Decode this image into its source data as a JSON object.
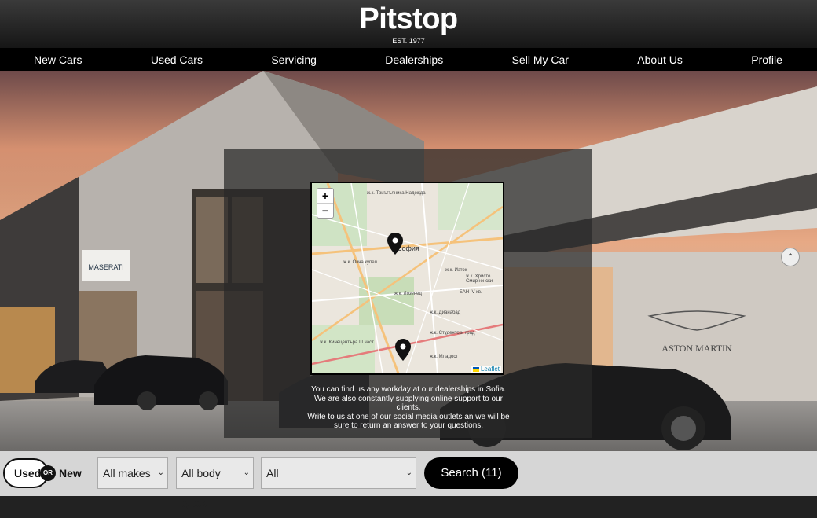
{
  "header": {
    "brand": "Pitstop",
    "est": "EST. 1977"
  },
  "nav": {
    "items": [
      {
        "label": "New Cars"
      },
      {
        "label": "Used Cars"
      },
      {
        "label": "Servicing"
      },
      {
        "label": "Dealerships"
      },
      {
        "label": "Sell My Car"
      },
      {
        "label": "About Us"
      },
      {
        "label": "Profile"
      }
    ]
  },
  "hero": {
    "brand_signs": {
      "aston": "ASTON MARTIN",
      "maserati": "MASERATI"
    }
  },
  "map": {
    "zoom_in": "+",
    "zoom_out": "−",
    "attribution": "Leaflet",
    "city_label": "София",
    "district_labels": [
      "ж.к. Триъгълника Надежда",
      "ж.к. Овча купел",
      "ж.к. Лозенец",
      "ж.к. Изток",
      "ж.к. Дианабад",
      "ж.к. Студентски град",
      "ж.к. Кинецентъра III част",
      "ж.к. Младост",
      "БАН IV кв.",
      "ж.к. Христо Смирненски"
    ]
  },
  "info": {
    "lines": [
      "You can find us any workday at our dealerships in Sofia.",
      "We are also constantly supplying online support to our clients.",
      "Write to us at one of our social media outlets an we will be sure to return an answer to your questions."
    ]
  },
  "search": {
    "toggle_used": "Used",
    "toggle_or": "OR",
    "toggle_new": "New",
    "makes": "All makes",
    "body_types": "All body types",
    "models": "All",
    "button": "Search (11)"
  }
}
